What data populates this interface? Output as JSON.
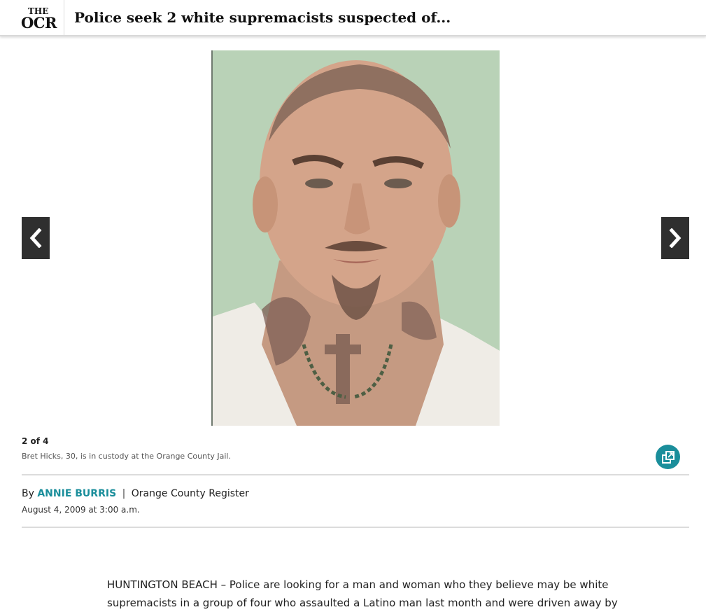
{
  "header": {
    "logo_top": "THE",
    "logo_bottom": "OCR",
    "headline": "Police seek 2 white supremacists suspected of..."
  },
  "gallery": {
    "counter": "2 of 4",
    "caption": "Bret Hicks, 30, is in custody at the Orange County Jail.",
    "prev_icon": "chevron-left-icon",
    "next_icon": "chevron-right-icon",
    "expand_icon": "expand-gallery-icon"
  },
  "byline": {
    "prefix": "By",
    "author": "ANNIE BURRIS",
    "separator": "|",
    "publication": "Orange County Register",
    "date": "August 4, 2009 at 3:00 a.m."
  },
  "article": {
    "line1": "HUNTINGTON BEACH – Police are looking for a man and woman who they believe may be white",
    "line2": "supremacists in a group of four who assaulted a Latino man last month and were driven away by"
  },
  "colors": {
    "accent": "#1a8e9b",
    "arrow_bg": "#2f2f2f",
    "photo_bg": "#b8d1b6"
  }
}
